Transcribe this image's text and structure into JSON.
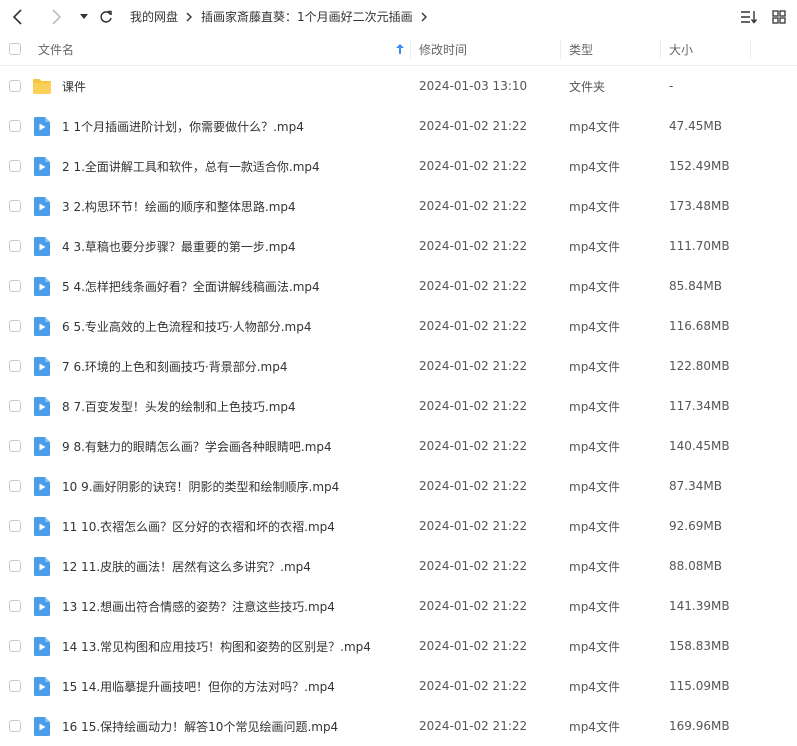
{
  "toolbar": {
    "breadcrumb": [
      "我的网盘",
      "插画家斎藤直葵：1个月画好二次元插画"
    ]
  },
  "header": {
    "name": "文件名",
    "time": "修改时间",
    "type": "类型",
    "size": "大小"
  },
  "rows": [
    {
      "kind": "folder",
      "name": "课件",
      "time": "2024-01-03 13:10",
      "type": "文件夹",
      "size": "-"
    },
    {
      "kind": "video",
      "name": "1 1个月插画进阶计划，你需要做什么？.mp4",
      "time": "2024-01-02 21:22",
      "type": "mp4文件",
      "size": "47.45MB"
    },
    {
      "kind": "video",
      "name": "2 1.全面讲解工具和软件，总有一款适合你.mp4",
      "time": "2024-01-02 21:22",
      "type": "mp4文件",
      "size": "152.49MB"
    },
    {
      "kind": "video",
      "name": "3 2.构思环节！绘画的顺序和整体思路.mp4",
      "time": "2024-01-02 21:22",
      "type": "mp4文件",
      "size": "173.48MB"
    },
    {
      "kind": "video",
      "name": "4 3.草稿也要分步骤？最重要的第一步.mp4",
      "time": "2024-01-02 21:22",
      "type": "mp4文件",
      "size": "111.70MB"
    },
    {
      "kind": "video",
      "name": "5 4.怎样把线条画好看？全面讲解线稿画法.mp4",
      "time": "2024-01-02 21:22",
      "type": "mp4文件",
      "size": "85.84MB"
    },
    {
      "kind": "video",
      "name": "6 5.专业高效的上色流程和技巧·人物部分.mp4",
      "time": "2024-01-02 21:22",
      "type": "mp4文件",
      "size": "116.68MB"
    },
    {
      "kind": "video",
      "name": "7 6.环境的上色和刻画技巧·背景部分.mp4",
      "time": "2024-01-02 21:22",
      "type": "mp4文件",
      "size": "122.80MB"
    },
    {
      "kind": "video",
      "name": "8 7.百变发型！头发的绘制和上色技巧.mp4",
      "time": "2024-01-02 21:22",
      "type": "mp4文件",
      "size": "117.34MB"
    },
    {
      "kind": "video",
      "name": "9 8.有魅力的眼睛怎么画？学会画各种眼睛吧.mp4",
      "time": "2024-01-02 21:22",
      "type": "mp4文件",
      "size": "140.45MB"
    },
    {
      "kind": "video",
      "name": "10 9.画好阴影的诀窍！阴影的类型和绘制顺序.mp4",
      "time": "2024-01-02 21:22",
      "type": "mp4文件",
      "size": "87.34MB"
    },
    {
      "kind": "video",
      "name": "11 10.衣褶怎么画？区分好的衣褶和坏的衣褶.mp4",
      "time": "2024-01-02 21:22",
      "type": "mp4文件",
      "size": "92.69MB"
    },
    {
      "kind": "video",
      "name": "12 11.皮肤的画法！居然有这么多讲究？.mp4",
      "time": "2024-01-02 21:22",
      "type": "mp4文件",
      "size": "88.08MB"
    },
    {
      "kind": "video",
      "name": "13 12.想画出符合情感的姿势？注意这些技巧.mp4",
      "time": "2024-01-02 21:22",
      "type": "mp4文件",
      "size": "141.39MB"
    },
    {
      "kind": "video",
      "name": "14 13.常见构图和应用技巧！构图和姿势的区别是？.mp4",
      "time": "2024-01-02 21:22",
      "type": "mp4文件",
      "size": "158.83MB"
    },
    {
      "kind": "video",
      "name": "15 14.用临摹提升画技吧！但你的方法对吗？.mp4",
      "time": "2024-01-02 21:22",
      "type": "mp4文件",
      "size": "115.09MB"
    },
    {
      "kind": "video",
      "name": "16 15.保持绘画动力！解答10个常见绘画问题.mp4",
      "time": "2024-01-02 21:22",
      "type": "mp4文件",
      "size": "169.96MB"
    }
  ],
  "icons": {
    "back": "chevron-left-icon",
    "forward": "chevron-right-icon",
    "dropdown": "caret-down-icon",
    "refresh": "refresh-icon",
    "sort": "sort-list-icon",
    "grid": "grid-view-icon",
    "folder": "folder-icon",
    "video": "video-file-icon",
    "sort_arrow": "sort-up-arrow-icon"
  },
  "colors": {
    "accent": "#3b8ff0",
    "folder": "#f7c443",
    "video": "#4a9de8",
    "border": "#ececec"
  }
}
